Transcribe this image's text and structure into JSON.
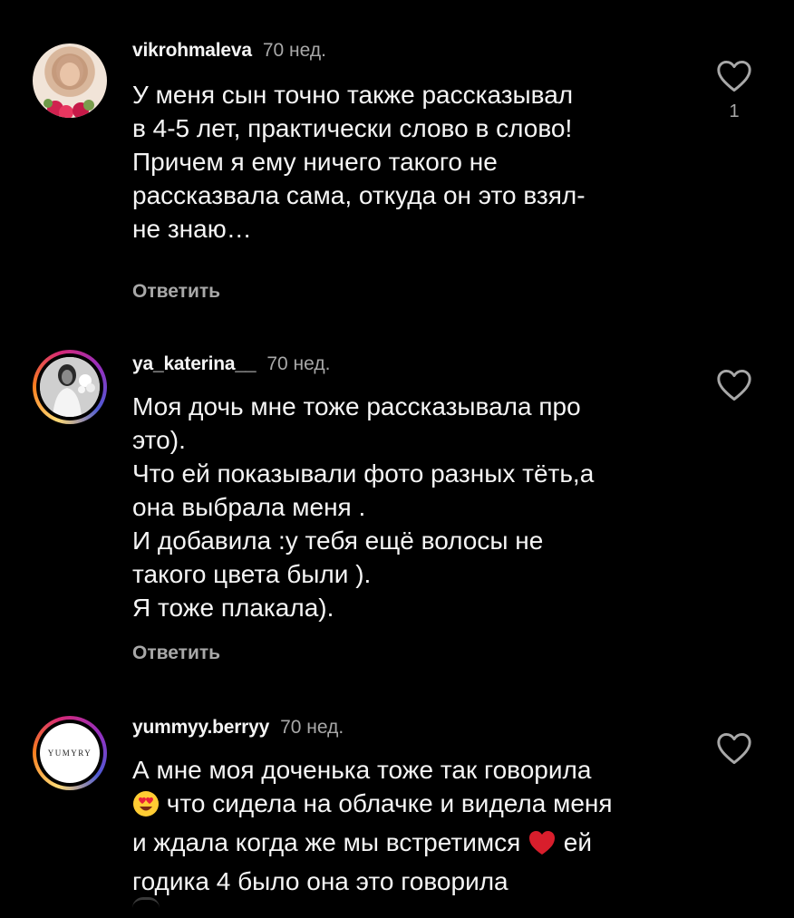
{
  "comments": [
    {
      "username": "vikrohmaleva",
      "time": "70 нед.",
      "lines": [
        "У меня сын точно также рассказывал",
        "в 4-5 лет, практически слово в слово!",
        "Причем я ему ничего такого не",
        "рассказвала сама, откуда он это взял-",
        "не знаю…"
      ],
      "reply_label": "Ответить",
      "likes": "1"
    },
    {
      "username": "ya_katerina__",
      "time": "70 нед.",
      "lines": [
        "Моя дочь мне тоже рассказывала про",
        "это).",
        "Что ей показывали фото разных тёть,а",
        "она выбрала меня .",
        "И добавила :у тебя ещё волосы не",
        "такого цвета были ).",
        "Я тоже плакала)."
      ],
      "reply_label": "Ответить"
    },
    {
      "username": "yummyy.berryy",
      "time": "70 нед.",
      "avatar_text": "YUMYRY",
      "line1": "А мне моя доченька тоже так говорила",
      "line2_after_emoji": " что сидела на облачке и видела меня",
      "line3_before_emoji": "и ждала когда же мы встретимся ",
      "line3_after_emoji": " ей",
      "line4": "годика 4 было она это говорила",
      "emoji_1": "heart-eyes-emoji",
      "emoji_2": "red-heart-emoji"
    }
  ],
  "icons": {
    "like": "heart-outline-icon"
  },
  "colors": {
    "background": "#000000",
    "text": "#f5f5f5",
    "secondary": "#a8a8a8"
  }
}
